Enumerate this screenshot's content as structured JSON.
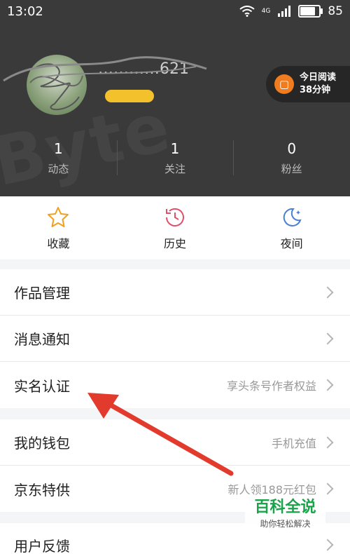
{
  "status_bar": {
    "time": "13:02",
    "network": "4G",
    "battery": "85",
    "battery_level": 0.85
  },
  "profile": {
    "username": "…………621",
    "reading_label": "今日阅读",
    "reading_time": "38分钟"
  },
  "stats": [
    {
      "value": "1",
      "label": "动态"
    },
    {
      "value": "1",
      "label": "关注"
    },
    {
      "value": "0",
      "label": "粉丝"
    }
  ],
  "quick_actions": [
    {
      "label": "收藏",
      "icon": "star-icon",
      "color": "#f0a020"
    },
    {
      "label": "历史",
      "icon": "clock-icon",
      "color": "#e0506a"
    },
    {
      "label": "夜间",
      "icon": "moon-icon",
      "color": "#4a7fd6"
    }
  ],
  "menu_group1": [
    {
      "title": "作品管理",
      "sub": ""
    },
    {
      "title": "消息通知",
      "sub": ""
    },
    {
      "title": "实名认证",
      "sub": "享头条号作者权益"
    }
  ],
  "menu_group2": [
    {
      "title": "我的钱包",
      "sub": "手机充值"
    },
    {
      "title": "京东特供",
      "sub": "新人领188元红包"
    }
  ],
  "menu_group3": [
    {
      "title": "用户反馈",
      "sub": ""
    }
  ],
  "watermark": {
    "line1": "百科全说",
    "line2": "助你轻松解决"
  },
  "colors": {
    "annotation_arrow": "#e23a2c",
    "watermark_green": "#1aa34a",
    "header_bg": "#3a3a3a"
  }
}
